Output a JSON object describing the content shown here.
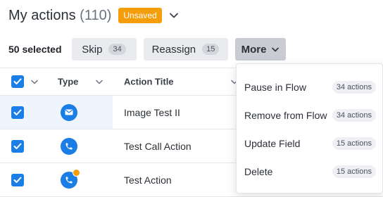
{
  "header": {
    "title": "My actions",
    "count": "(110)",
    "unsaved_badge": "Unsaved"
  },
  "toolbar": {
    "selected_label": "50 selected",
    "skip_label": "Skip",
    "skip_count": "34",
    "reassign_label": "Reassign",
    "reassign_count": "15",
    "more_label": "More"
  },
  "table": {
    "columns": {
      "type": "Type",
      "title": "Action Title"
    },
    "rows": [
      {
        "type_icon": "email-icon",
        "title": "Image Test II",
        "selected": true
      },
      {
        "type_icon": "phone-icon",
        "title": "Test Call Action",
        "selected": true
      },
      {
        "type_icon": "phone-icon",
        "title": "Test Action",
        "selected": true
      }
    ]
  },
  "more_menu": {
    "items": [
      {
        "label": "Pause in Flow",
        "count": "34 actions"
      },
      {
        "label": "Remove from Flow",
        "count": "34 actions"
      },
      {
        "label": "Update Field",
        "count": "15 actions"
      },
      {
        "label": "Delete",
        "count": "15 actions"
      }
    ]
  },
  "colors": {
    "accent": "#1a7ee6",
    "unsaved": "#f59e0b",
    "highlight": "#eef5fd"
  }
}
